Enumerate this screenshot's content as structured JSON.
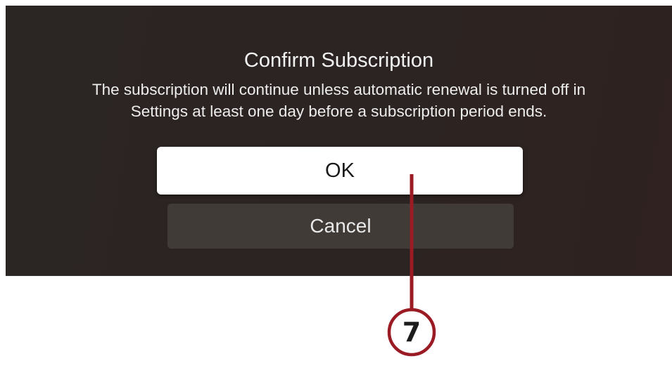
{
  "dialog": {
    "title": "Confirm Subscription",
    "message_line1": "The subscription will continue unless automatic renewal is turned off in",
    "message_line2": "Settings at least one day before a subscription period ends.",
    "ok_label": "OK",
    "cancel_label": "Cancel"
  },
  "callout": {
    "number": "7",
    "color": "#9b1b24"
  },
  "colors": {
    "background": "#2c2422",
    "ok_button": "#ffffff",
    "cancel_button": "#413b38",
    "text": "#f2f2f2"
  }
}
